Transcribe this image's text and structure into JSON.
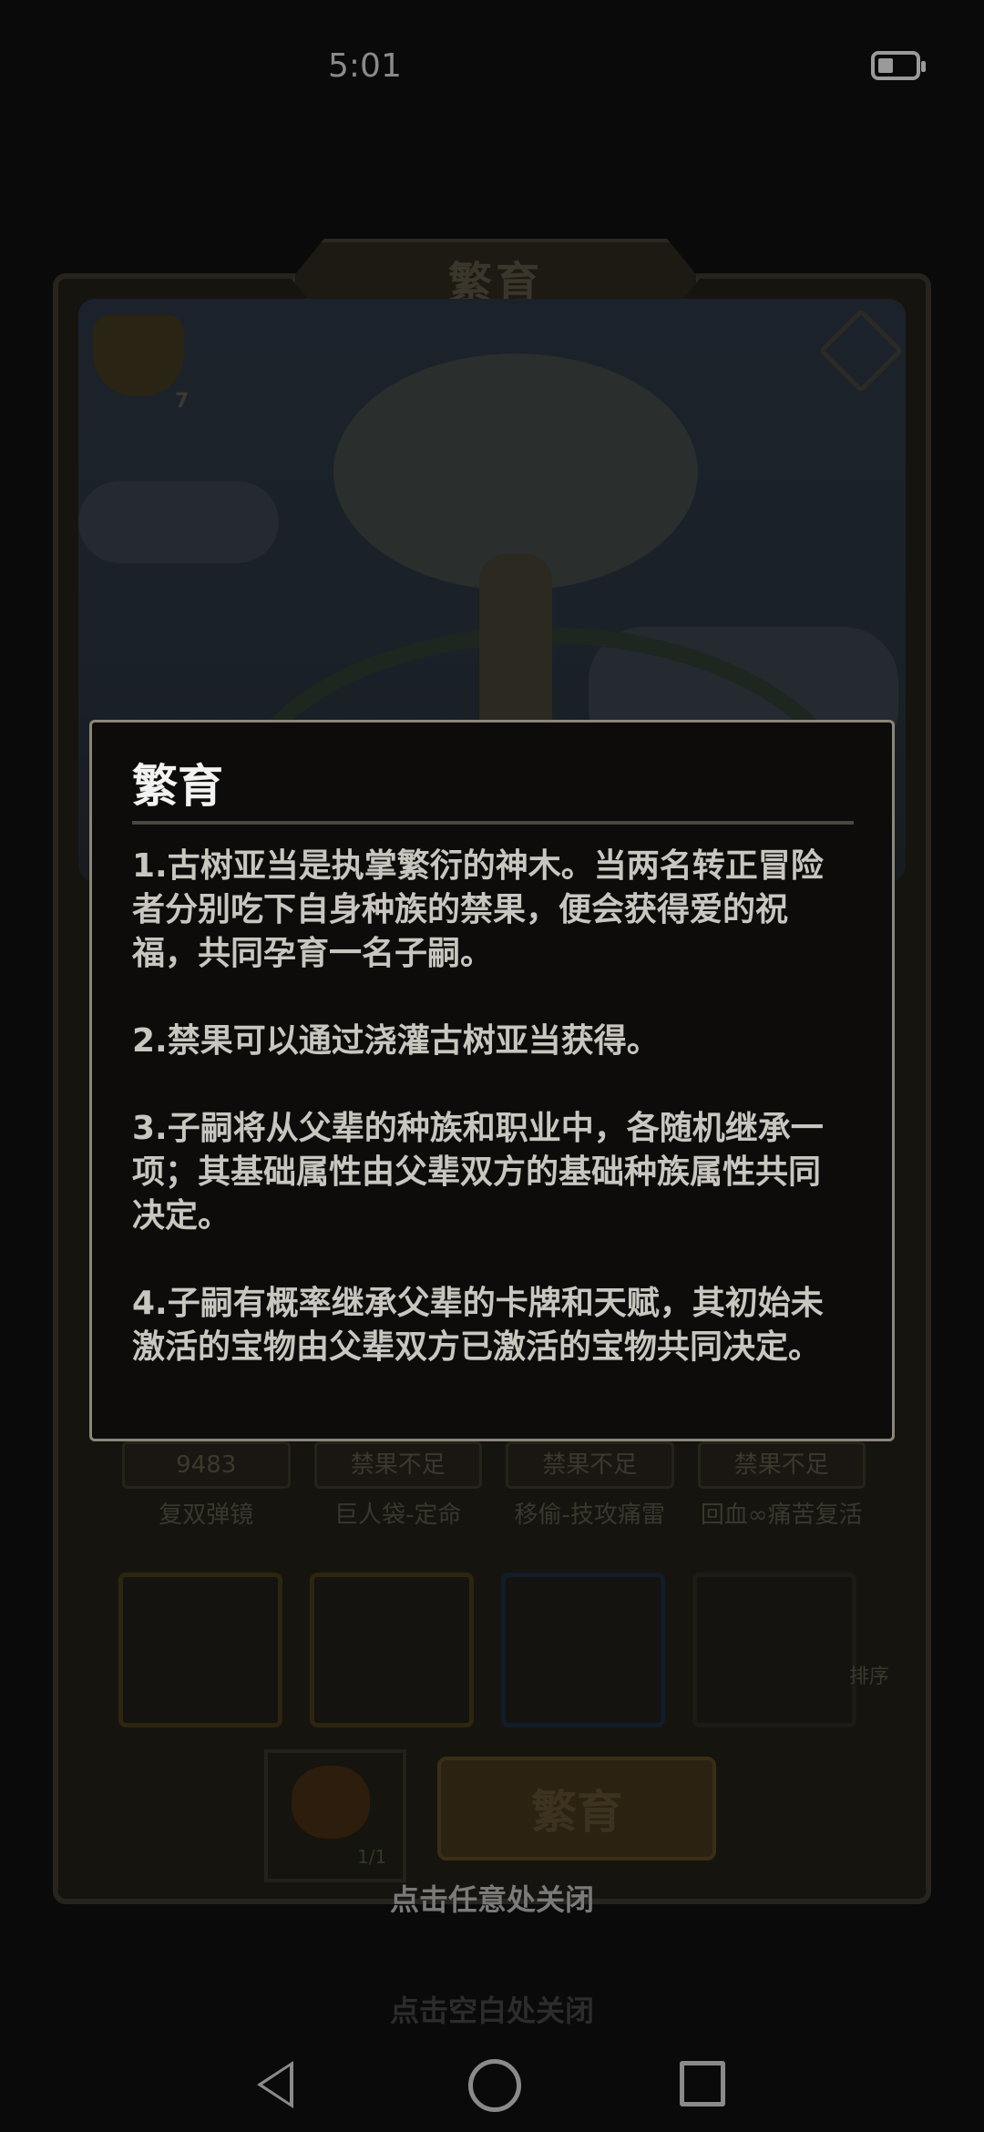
{
  "status_bar": {
    "time": "5:01",
    "battery_icon": "battery-icon"
  },
  "game": {
    "panel_title": "繁育",
    "basket_count": "7",
    "help_icon": "help-diamond-icon",
    "breed_points": "9483",
    "cards": [
      {
        "count": "",
        "name": "复双弹镜"
      },
      {
        "count": "禁果不足",
        "name": "巨人袋-定命"
      },
      {
        "count": "禁果不足",
        "name": "移偷-技攻痛雷"
      },
      {
        "count": "禁果不足",
        "name": "回血∞痛苦复活"
      }
    ],
    "sort_label": "排序",
    "slot_count": "1/1",
    "breed_button": "繁育"
  },
  "modal": {
    "title": "繁育",
    "paragraphs": [
      "1.古树亚当是执掌繁衍的神木。当两名转正冒险者分别吃下自身种族的禁果，便会获得爱的祝福，共同孕育一名子嗣。",
      "2.禁果可以通过浇灌古树亚当获得。",
      "3.子嗣将从父辈的种族和职业中，各随机继承一项；其基础属性由父辈双方的基础种族属性共同决定。",
      "4.子嗣有概率继承父辈的卡牌和天赋，其初始未激活的宝物由父辈双方已激活的宝物共同决定。"
    ]
  },
  "close_hint": "点击任意处关闭",
  "close_hint_background": "点击空白处关闭",
  "nav": {
    "back_icon": "back-icon",
    "home_icon": "home-icon",
    "recents_icon": "recents-icon"
  }
}
